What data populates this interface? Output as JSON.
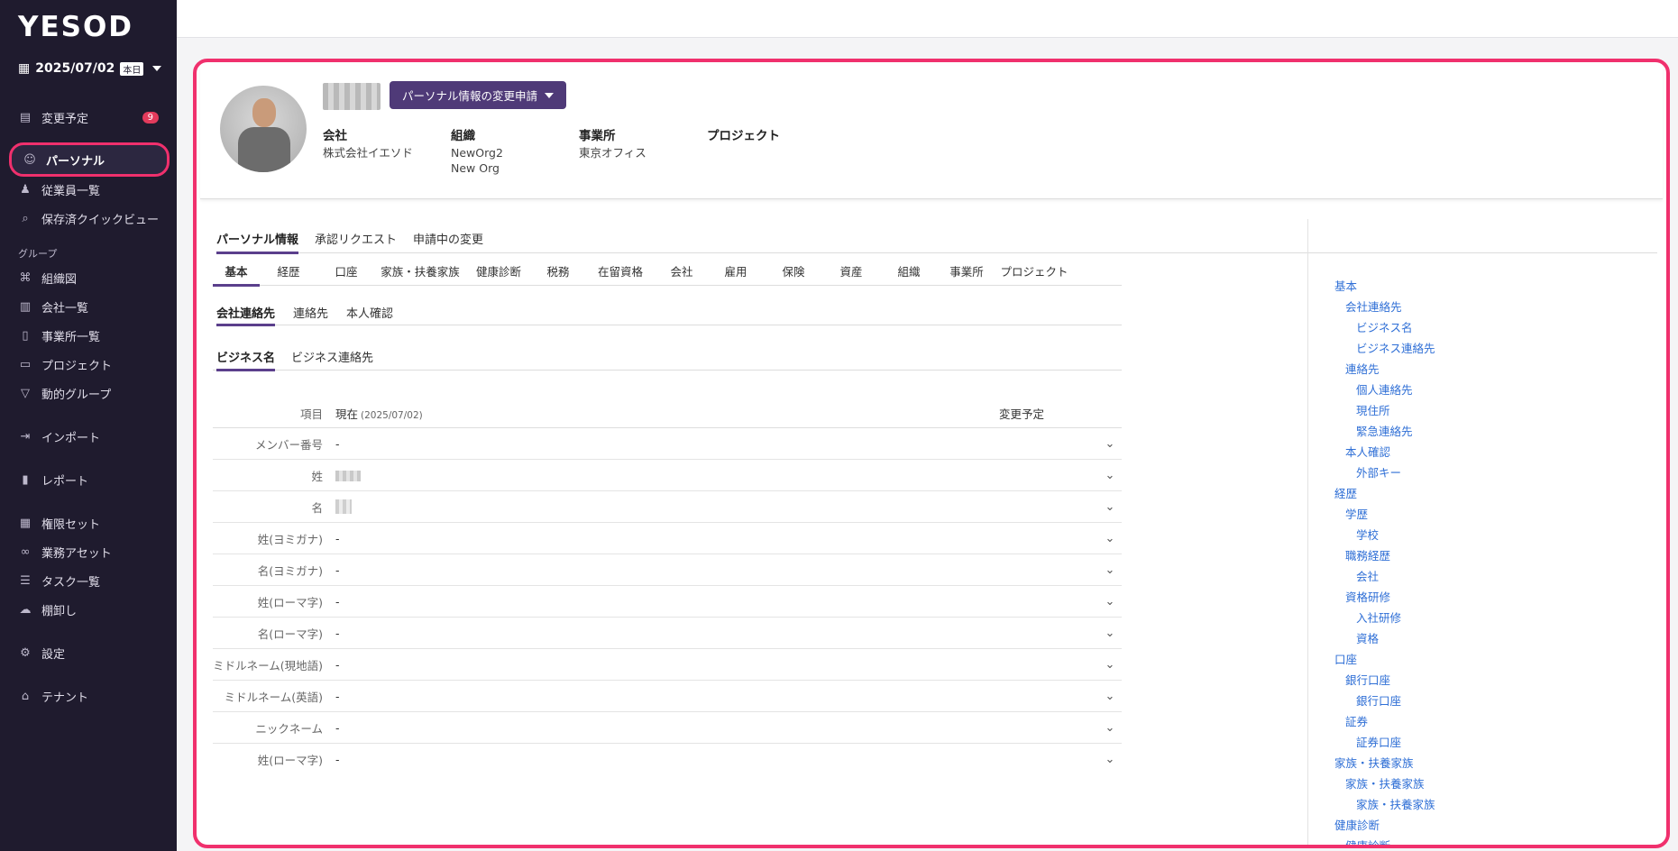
{
  "sidebar": {
    "logo": "YESOD",
    "date": "2025/07/02",
    "today_badge": "本日",
    "items": [
      {
        "label": "変更予定",
        "badge": "9"
      },
      {
        "label": "パーソナル"
      },
      {
        "label": "従業員一覧"
      },
      {
        "label": "保存済クイックビュー"
      }
    ],
    "group_label": "グループ",
    "group_items": [
      {
        "label": "組織図"
      },
      {
        "label": "会社一覧"
      },
      {
        "label": "事業所一覧"
      },
      {
        "label": "プロジェクト"
      },
      {
        "label": "動的グループ"
      }
    ],
    "bottom_items": [
      {
        "label": "インポート"
      },
      {
        "label": "レポート"
      },
      {
        "label": "権限セット"
      },
      {
        "label": "業務アセット"
      },
      {
        "label": "タスク一覧"
      },
      {
        "label": "棚卸し"
      },
      {
        "label": "設定"
      },
      {
        "label": "テナント"
      }
    ]
  },
  "profile": {
    "request_button": "パーソナル情報の変更申請",
    "company_label": "会社",
    "company_value": "株式会社イエソド",
    "org_label": "組織",
    "org_values": [
      "NewOrg2",
      "New Org"
    ],
    "office_label": "事業所",
    "office_value": "東京オフィス",
    "project_label": "プロジェクト"
  },
  "main_tabs": [
    "パーソナル情報",
    "承認リクエスト",
    "申請中の変更"
  ],
  "sub_tabs": [
    "基本",
    "経歴",
    "口座",
    "家族・扶養家族",
    "健康診断",
    "税務",
    "在留資格",
    "会社",
    "雇用",
    "保険",
    "資産",
    "組織",
    "事業所",
    "プロジェクト"
  ],
  "section_tabs": [
    "会社連絡先",
    "連絡先",
    "本人確認"
  ],
  "group_tabs": [
    "ビジネス名",
    "ビジネス連絡先"
  ],
  "table": {
    "col_item": "項目",
    "col_current": "現在",
    "current_date": "(2025/07/02)",
    "col_next": "変更予定",
    "rows": [
      {
        "label": "メンバー番号",
        "value": "-"
      },
      {
        "label": "姓",
        "value": ""
      },
      {
        "label": "名",
        "value": ""
      },
      {
        "label": "姓(ヨミガナ)",
        "value": "-"
      },
      {
        "label": "名(ヨミガナ)",
        "value": "-"
      },
      {
        "label": "姓(ローマ字)",
        "value": "-"
      },
      {
        "label": "名(ローマ字)",
        "value": "-"
      },
      {
        "label": "ミドルネーム(現地語)",
        "value": "-"
      },
      {
        "label": "ミドルネーム(英語)",
        "value": "-"
      },
      {
        "label": "ニックネーム",
        "value": "-"
      },
      {
        "label": "姓(ローマ字)",
        "value": "-"
      }
    ]
  },
  "toc": [
    {
      "level": 1,
      "label": "基本"
    },
    {
      "level": 2,
      "label": "会社連絡先"
    },
    {
      "level": 3,
      "label": "ビジネス名"
    },
    {
      "level": 3,
      "label": "ビジネス連絡先"
    },
    {
      "level": 2,
      "label": "連絡先"
    },
    {
      "level": 3,
      "label": "個人連絡先"
    },
    {
      "level": 3,
      "label": "現住所"
    },
    {
      "level": 3,
      "label": "緊急連絡先"
    },
    {
      "level": 2,
      "label": "本人確認"
    },
    {
      "level": 3,
      "label": "外部キー"
    },
    {
      "level": 1,
      "label": "経歴"
    },
    {
      "level": 2,
      "label": "学歴"
    },
    {
      "level": 3,
      "label": "学校"
    },
    {
      "level": 2,
      "label": "職務経歴"
    },
    {
      "level": 3,
      "label": "会社"
    },
    {
      "level": 2,
      "label": "資格研修"
    },
    {
      "level": 3,
      "label": "入社研修"
    },
    {
      "level": 3,
      "label": "資格"
    },
    {
      "level": 1,
      "label": "口座"
    },
    {
      "level": 2,
      "label": "銀行口座"
    },
    {
      "level": 3,
      "label": "銀行口座"
    },
    {
      "level": 2,
      "label": "証券"
    },
    {
      "level": 3,
      "label": "証券口座"
    },
    {
      "level": 1,
      "label": "家族・扶養家族"
    },
    {
      "level": 2,
      "label": "家族・扶養家族"
    },
    {
      "level": 3,
      "label": "家族・扶養家族"
    },
    {
      "level": 1,
      "label": "健康診断"
    },
    {
      "level": 2,
      "label": "健康診断"
    }
  ],
  "colors": {
    "accent": "#4f3a78",
    "highlight": "#f0306d",
    "sidebar_bg": "#1f1b2e",
    "link": "#2f6fd6"
  }
}
